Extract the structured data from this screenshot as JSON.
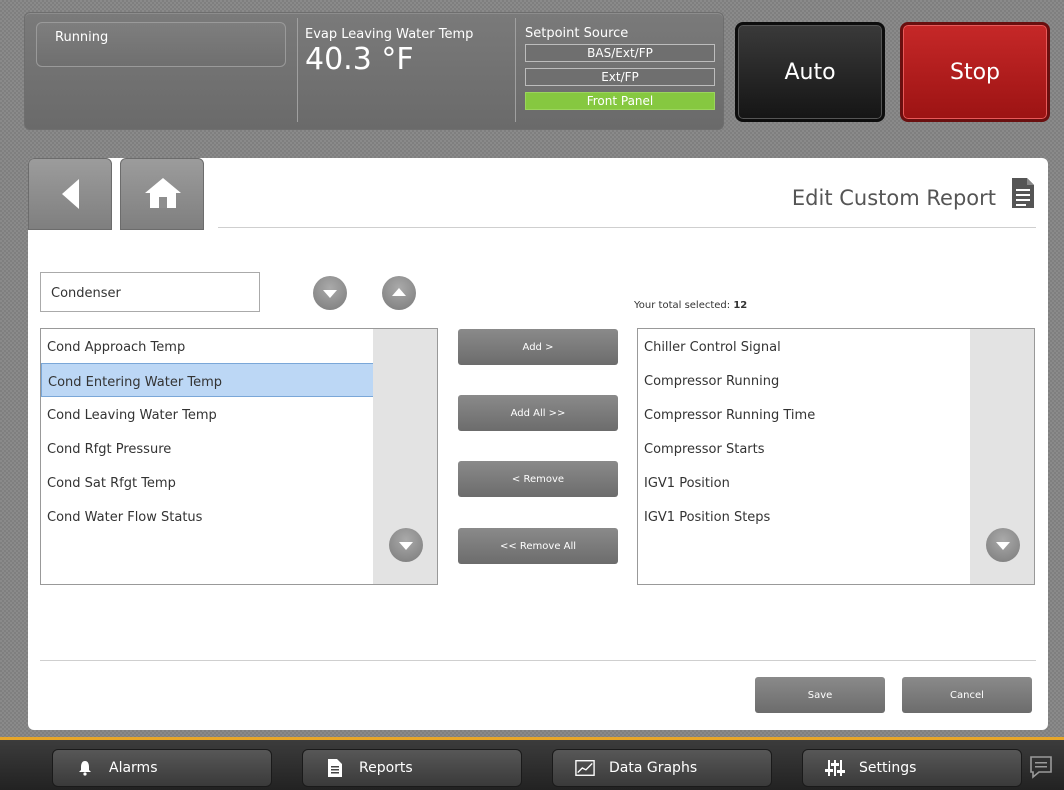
{
  "header": {
    "state": "Running",
    "evap_label": "Evap Leaving Water Temp",
    "evap_value": "40.3 °F",
    "setpoint_label": "Setpoint Source",
    "setpoint_options": [
      "BAS/Ext/FP",
      "Ext/FP",
      "Front Panel"
    ],
    "setpoint_active": "Front Panel",
    "auto_label": "Auto",
    "stop_label": "Stop"
  },
  "page": {
    "title": "Edit Custom Report",
    "category": "Condenser",
    "total_label": "Your total selected:",
    "total_count": "12"
  },
  "available": {
    "items": [
      "Cond Approach Temp",
      "Cond Entering Water Temp",
      "Cond Leaving Water Temp",
      "Cond Rfgt Pressure",
      "Cond Sat Rfgt Temp",
      "Cond Water Flow Status"
    ],
    "selected_item": "Cond Entering Water Temp"
  },
  "selected": {
    "items": [
      "Chiller Control Signal",
      "Compressor Running",
      "Compressor Running Time",
      "Compressor Starts",
      "IGV1 Position",
      "IGV1 Position Steps"
    ]
  },
  "move_buttons": {
    "add": "Add >",
    "add_all": "Add All >>",
    "remove": "< Remove",
    "remove_all": "<< Remove All"
  },
  "actions": {
    "save": "Save",
    "cancel": "Cancel"
  },
  "footer": {
    "alarms": "Alarms",
    "reports": "Reports",
    "data_graphs": "Data Graphs",
    "settings": "Settings"
  },
  "colors": {
    "stop": "#b51c1c",
    "setpoint_active": "#86c840",
    "footer_accent": "#e6a62a",
    "selection": "#bcd7f5"
  }
}
